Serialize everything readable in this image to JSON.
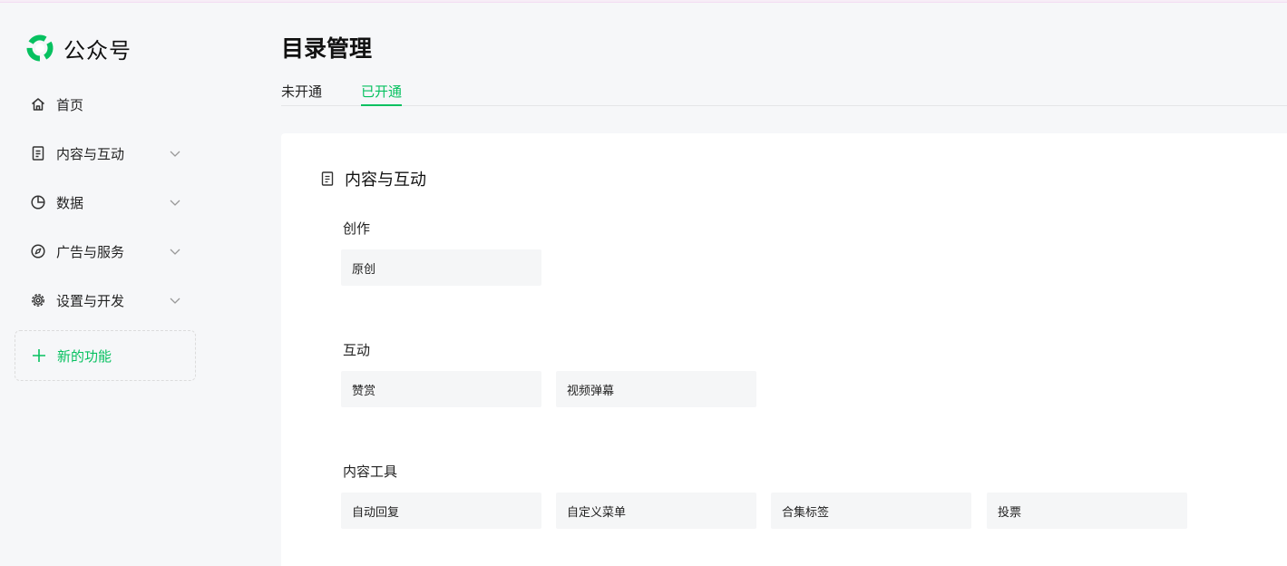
{
  "brand": {
    "name": "公众号",
    "logo_icon": "wechat-official-account-logo",
    "accent": "#07c160"
  },
  "sidebar": {
    "items": [
      {
        "label": "首页",
        "icon": "home-icon",
        "expandable": false
      },
      {
        "label": "内容与互动",
        "icon": "document-icon",
        "expandable": true
      },
      {
        "label": "数据",
        "icon": "pie-chart-icon",
        "expandable": true
      },
      {
        "label": "广告与服务",
        "icon": "compass-icon",
        "expandable": true
      },
      {
        "label": "设置与开发",
        "icon": "gear-icon",
        "expandable": true
      }
    ],
    "new_feature": {
      "label": "新的功能",
      "icon": "plus-icon"
    }
  },
  "page": {
    "title": "目录管理"
  },
  "tabs": [
    {
      "label": "未开通",
      "active": false
    },
    {
      "label": "已开通",
      "active": true
    }
  ],
  "section": {
    "title": "内容与互动",
    "icon": "document-icon",
    "groups": [
      {
        "label": "创作",
        "features": [
          "原创"
        ]
      },
      {
        "label": "互动",
        "features": [
          "赞赏",
          "视频弹幕"
        ]
      },
      {
        "label": "内容工具",
        "features": [
          "自动回复",
          "自定义菜单",
          "合集标签",
          "投票"
        ]
      }
    ]
  }
}
